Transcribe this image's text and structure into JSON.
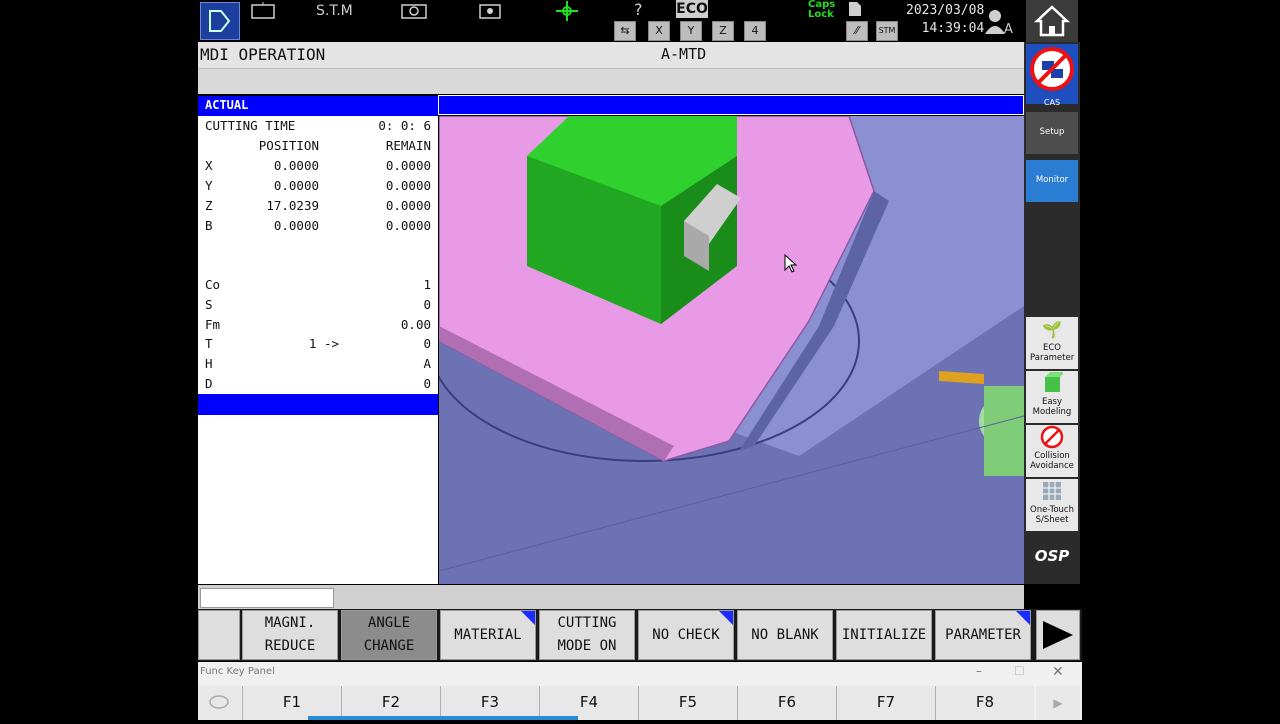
{
  "topbar": {
    "mode_indicator": "S.T.M",
    "eco_label": "ECO",
    "caps_lock_label": "Caps Lock",
    "stm_label": "STM",
    "date": "2023/03/08",
    "time": "14:39:04",
    "user_label": "A"
  },
  "title": {
    "mode": "MDI OPERATION",
    "machine": "A-MTD"
  },
  "info": {
    "header": "ACTUAL",
    "cutting_time_label": "CUTTING TIME",
    "cutting_time_value": "0: 0: 6",
    "position_header": "POSITION",
    "remain_header": "REMAIN",
    "axes": [
      {
        "axis": "X",
        "position": "0.0000",
        "remain": "0.0000"
      },
      {
        "axis": "Y",
        "position": "0.0000",
        "remain": "0.0000"
      },
      {
        "axis": "Z",
        "position": "17.0239",
        "remain": "0.0000"
      },
      {
        "axis": "B",
        "position": "0.0000",
        "remain": "0.0000"
      }
    ],
    "status": [
      {
        "label": "Co",
        "mid": "",
        "value": "1"
      },
      {
        "label": "S",
        "mid": "",
        "value": "0"
      },
      {
        "label": "Fm",
        "mid": "",
        "value": "0.00"
      },
      {
        "label": "T",
        "mid": "1 ->",
        "value": "0"
      },
      {
        "label": "H",
        "mid": "",
        "value": "A"
      },
      {
        "label": "D",
        "mid": "",
        "value": "0"
      }
    ]
  },
  "sidebar": {
    "cas_label": "CAS",
    "setup_label": "Setup",
    "monitor_label": "Monitor",
    "eco_param_label": "ECO Parameter",
    "easy_modeling_label": "Easy Modeling",
    "collision_label": "Collision Avoidance",
    "onetouch_label": "One-Touch S/Sheet",
    "osp_label": "OSP"
  },
  "fkeys": [
    {
      "line1": "MAGNI.",
      "line2": "REDUCE",
      "active": false,
      "corner": false
    },
    {
      "line1": "ANGLE",
      "line2": "CHANGE",
      "active": true,
      "corner": false
    },
    {
      "line1": "MATERIAL",
      "line2": "",
      "active": false,
      "corner": true
    },
    {
      "line1": "CUTTING",
      "line2": "MODE ON",
      "active": false,
      "corner": false
    },
    {
      "line1": "NO CHECK",
      "line2": "",
      "active": false,
      "corner": true
    },
    {
      "line1": "NO BLANK",
      "line2": "",
      "active": false,
      "corner": false
    },
    {
      "line1": "INITIALIZE",
      "line2": "",
      "active": false,
      "corner": false
    },
    {
      "line1": "PARAMETER",
      "line2": "",
      "active": false,
      "corner": true
    }
  ],
  "fkpanel": {
    "title": "Func Key Panel",
    "keys": [
      "F1",
      "F2",
      "F3",
      "F4",
      "F5",
      "F6",
      "F7",
      "F8"
    ]
  },
  "colors": {
    "accent_blue": "#0000ff",
    "workpiece_pink": "#e89ae6",
    "tool_green": "#2fd12f"
  }
}
